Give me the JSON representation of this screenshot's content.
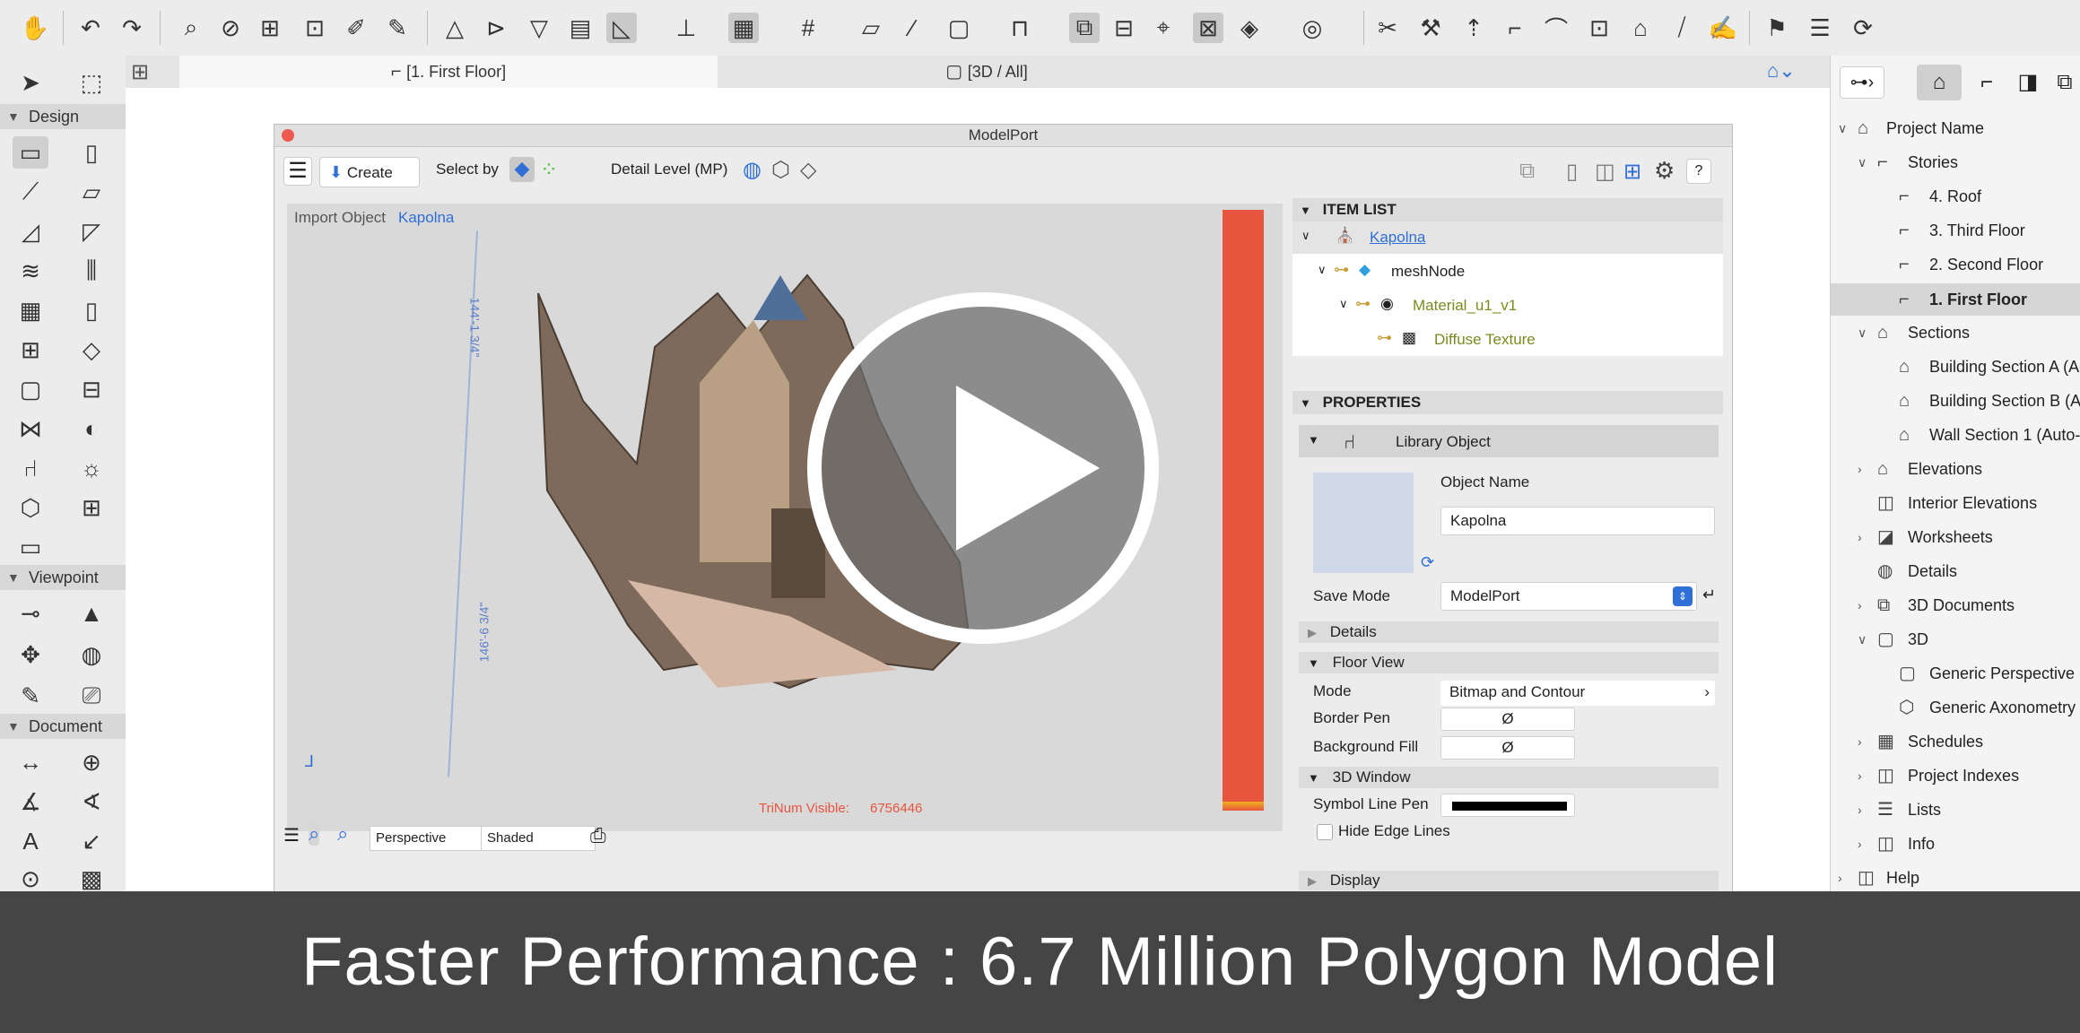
{
  "tabs": {
    "floor": "[1. First Floor]",
    "threed": "[3D / All]"
  },
  "toolbox": {
    "design": "Design",
    "viewpoint": "Viewpoint",
    "document": "Document"
  },
  "modelport": {
    "title": "ModelPort",
    "create_label": "Create",
    "select_by_label": "Select by",
    "detail_level_label": "Detail Level (MP)",
    "help_label": "?",
    "import_object_label": "Import Object",
    "import_object_value": "Kapolna",
    "axis_dimension": "146'-6 3/4\"",
    "axis_dimension_2": "144'-1 3/4\"",
    "trinum_label": "TriNum Visible:",
    "trinum_value": "6756446",
    "view_mode": "Perspective",
    "render_mode": "Shaded",
    "item_list": {
      "header": "ITEM LIST",
      "root": "Kapolna",
      "mesh": "meshNode",
      "material": "Material_u1_v1",
      "texture": "Diffuse Texture"
    },
    "properties": {
      "header": "PROPERTIES",
      "library_object": "Library Object",
      "object_name_label": "Object Name",
      "object_name_value": "Kapolna",
      "save_mode_label": "Save Mode",
      "save_mode_value": "ModelPort",
      "details": "Details",
      "floor_view": "Floor View",
      "mode_label": "Mode",
      "mode_value": "Bitmap and Contour",
      "border_pen_label": "Border Pen",
      "border_pen_value": "Ø",
      "background_fill_label": "Background Fill",
      "background_fill_value": "Ø",
      "window_3d": "3D Window",
      "symbol_line_pen_label": "Symbol Line Pen",
      "hide_edge_lines_label": "Hide Edge Lines",
      "display": "Display"
    }
  },
  "navigator": {
    "project_name": "Project Name",
    "stories": "Stories",
    "story_items": [
      "4. Roof",
      "3. Third Floor",
      "2. Second Floor",
      "1. First Floor"
    ],
    "sections": "Sections",
    "section_items": [
      "Building Section A (A",
      "Building Section B (A",
      "Wall Section 1 (Auto-"
    ],
    "elevations": "Elevations",
    "interior_elevations": "Interior Elevations",
    "worksheets": "Worksheets",
    "details": "Details",
    "documents_3d": "3D Documents",
    "threed": "3D",
    "threed_items": [
      "Generic Perspective",
      "Generic Axonometry"
    ],
    "schedules": "Schedules",
    "project_indexes": "Project Indexes",
    "lists": "Lists",
    "info": "Info",
    "help": "Help"
  },
  "caption": "Faster Performance : 6.7 Million Polygon Model",
  "colors": {
    "accent_blue": "#2f6fd6",
    "trinum_red": "#e8553f",
    "caption_bg": "#454545",
    "material_green": "#7a8a1f"
  }
}
